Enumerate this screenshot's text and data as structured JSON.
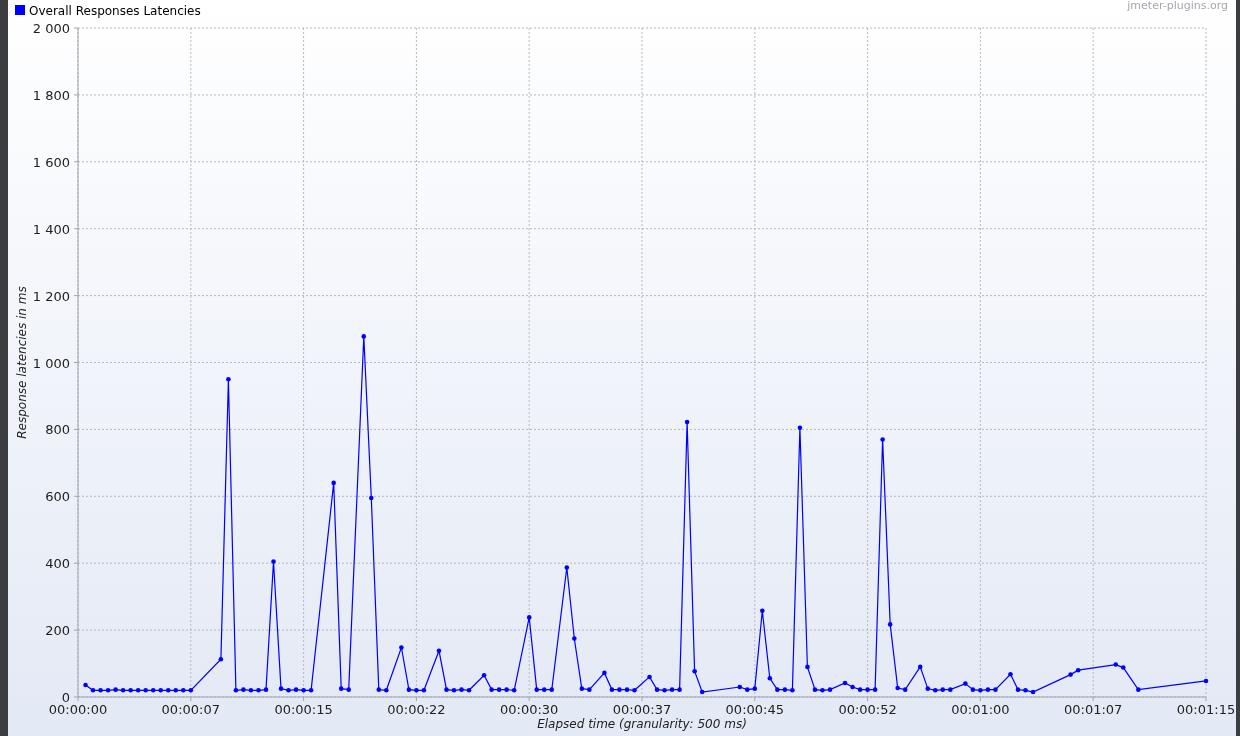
{
  "credit": "jmeter-plugins.org",
  "chart_data": {
    "type": "line",
    "grid": true,
    "xlabel": "Elapsed time (granularity: 500 ms)",
    "ylabel": "Response latencies in ms",
    "xlim": [
      0,
      75
    ],
    "ylim": [
      0,
      2000
    ],
    "xticks": [
      {
        "value": 0,
        "label": "00:00:00"
      },
      {
        "value": 7.5,
        "label": "00:00:07"
      },
      {
        "value": 15,
        "label": "00:00:15"
      },
      {
        "value": 22.5,
        "label": "00:00:22"
      },
      {
        "value": 30,
        "label": "00:00:30"
      },
      {
        "value": 37.5,
        "label": "00:00:37"
      },
      {
        "value": 45,
        "label": "00:00:45"
      },
      {
        "value": 52.5,
        "label": "00:00:52"
      },
      {
        "value": 60,
        "label": "00:01:00"
      },
      {
        "value": 67.5,
        "label": "00:01:07"
      },
      {
        "value": 75,
        "label": "00:01:15"
      }
    ],
    "yticks": [
      {
        "value": 0,
        "label": "0"
      },
      {
        "value": 200,
        "label": "200"
      },
      {
        "value": 400,
        "label": "400"
      },
      {
        "value": 600,
        "label": "600"
      },
      {
        "value": 800,
        "label": "800"
      },
      {
        "value": 1000,
        "label": "1 000"
      },
      {
        "value": 1200,
        "label": "1 200"
      },
      {
        "value": 1400,
        "label": "1 400"
      },
      {
        "value": 1600,
        "label": "1 600"
      },
      {
        "value": 1800,
        "label": "1 800"
      },
      {
        "value": 2000,
        "label": "2 000"
      }
    ],
    "x": [
      0.5,
      1,
      1.5,
      2,
      2.5,
      3,
      3.5,
      4,
      4.5,
      5,
      5.5,
      6,
      6.5,
      7,
      7.5,
      9.5,
      10,
      10.5,
      11,
      11.5,
      12,
      12.5,
      13,
      13.5,
      14,
      14.5,
      15,
      15.5,
      17,
      17.5,
      18,
      19,
      19.5,
      20,
      20.5,
      21.5,
      22,
      22.5,
      23,
      24,
      24.5,
      25,
      25.5,
      26,
      27,
      27.5,
      28,
      28.5,
      29,
      30,
      30.5,
      31,
      31.5,
      32.5,
      33,
      33.5,
      34,
      35,
      35.5,
      36,
      36.5,
      37,
      38,
      38.5,
      39,
      39.5,
      40,
      40.5,
      41,
      41.5,
      44,
      44.5,
      45,
      45.5,
      46,
      46.5,
      47,
      47.5,
      48,
      48.5,
      49,
      49.5,
      50,
      51,
      51.5,
      52,
      52.5,
      53,
      53.5,
      54,
      54.5,
      55,
      56,
      56.5,
      57,
      57.5,
      58,
      59,
      59.5,
      60,
      60.5,
      61,
      62,
      62.5,
      63,
      63.5,
      66,
      66.5,
      69,
      69.5,
      70.5,
      75
    ],
    "series": [
      {
        "name": "Overall Responses Latencies",
        "color": "#0000ff",
        "values": [
          36,
          20,
          20,
          20,
          22,
          20,
          20,
          20,
          20,
          20,
          20,
          20,
          20,
          20,
          20,
          113,
          950,
          20,
          22,
          20,
          20,
          22,
          405,
          25,
          20,
          22,
          20,
          20,
          640,
          25,
          22,
          1078,
          595,
          22,
          20,
          148,
          22,
          20,
          20,
          138,
          22,
          20,
          22,
          20,
          65,
          22,
          22,
          22,
          20,
          238,
          22,
          22,
          22,
          387,
          175,
          25,
          22,
          72,
          22,
          22,
          22,
          20,
          60,
          22,
          20,
          22,
          22,
          822,
          77,
          15,
          30,
          22,
          25,
          258,
          56,
          22,
          22,
          20,
          805,
          90,
          22,
          20,
          22,
          42,
          30,
          22,
          22,
          22,
          770,
          217,
          27,
          22,
          90,
          25,
          20,
          22,
          22,
          40,
          22,
          20,
          22,
          22,
          68,
          22,
          20,
          15,
          67,
          80,
          97,
          88,
          22,
          48
        ]
      }
    ]
  }
}
